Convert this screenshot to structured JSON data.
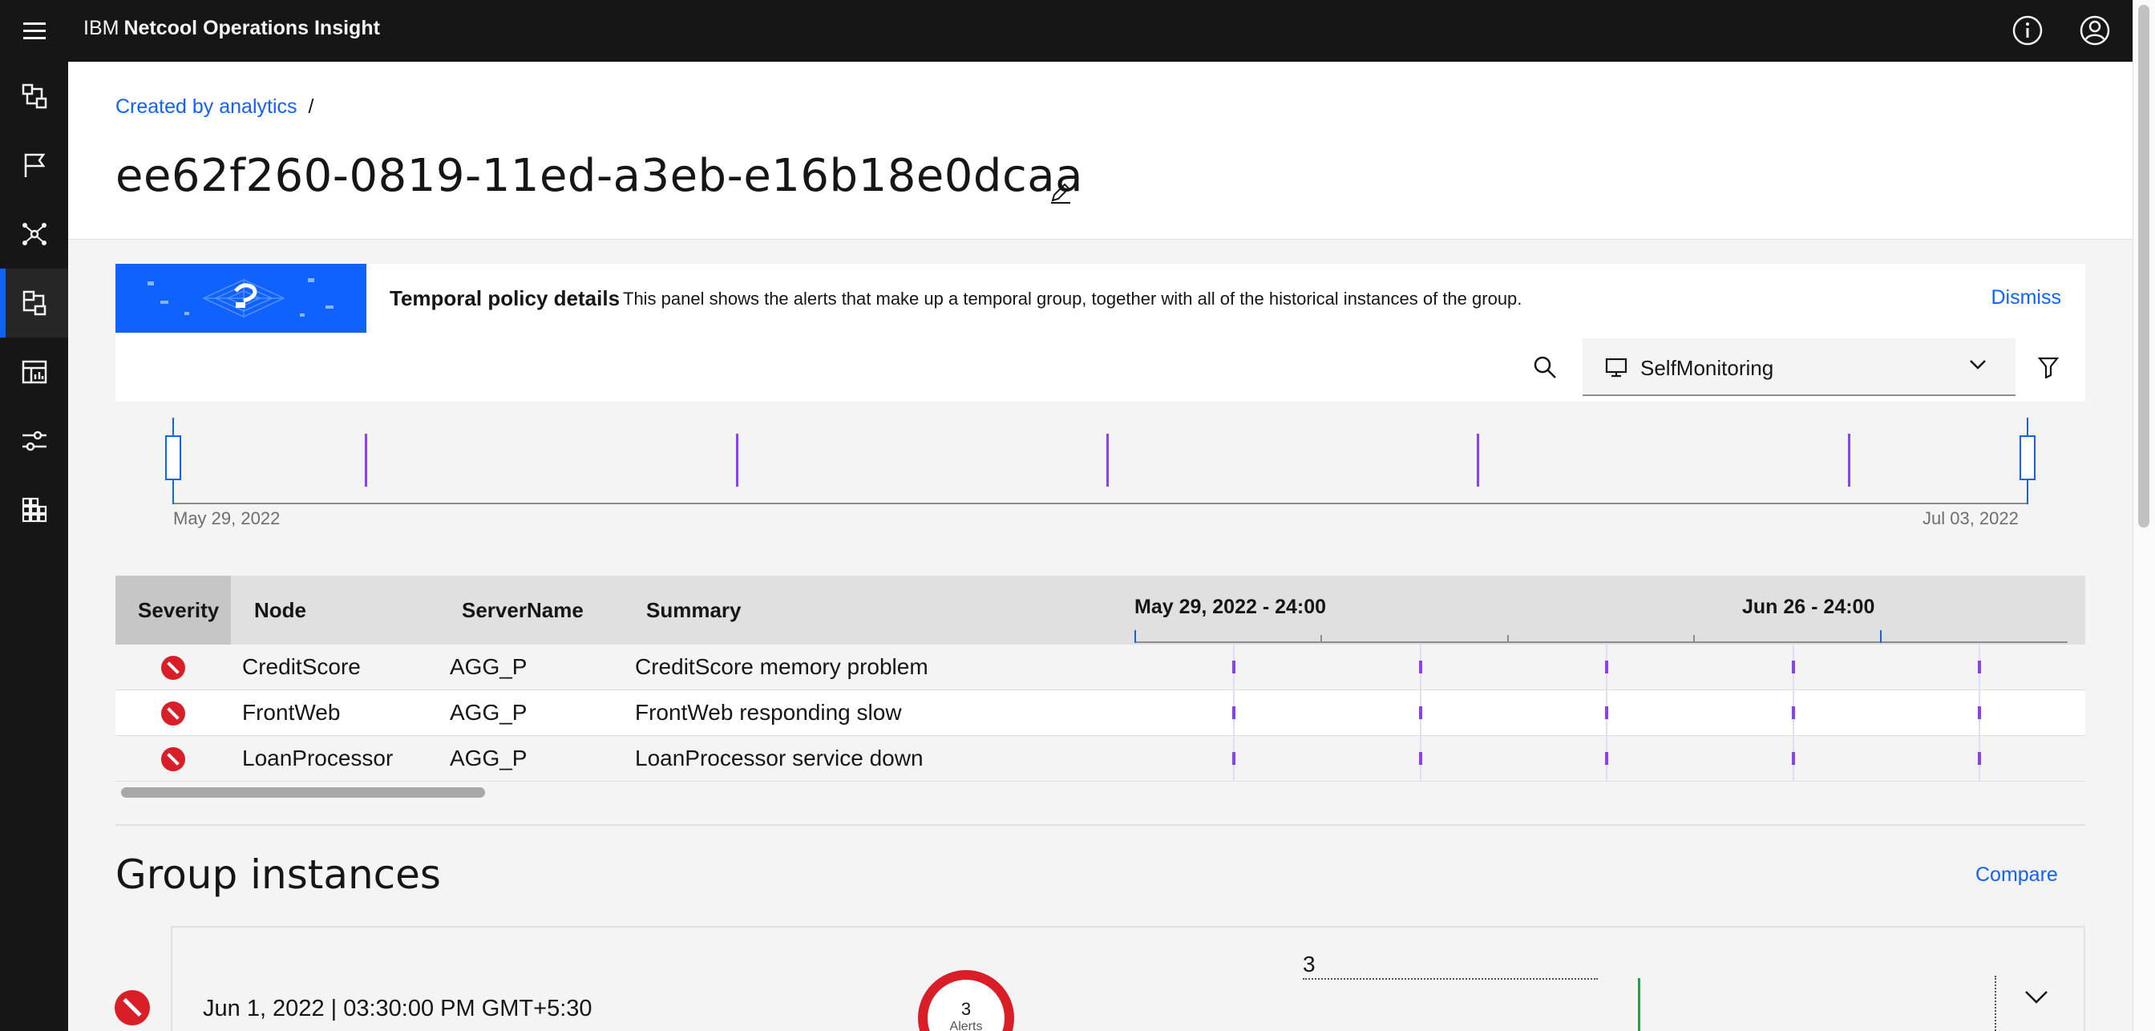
{
  "header": {
    "brand": "IBM",
    "product": "Netcool Operations Insight"
  },
  "breadcrumb": {
    "link": "Created by analytics",
    "separator": "/"
  },
  "page": {
    "title": "ee62f260-0819-11ed-a3eb-e16b18e0dcaa"
  },
  "info_panel": {
    "heading": "Temporal policy details",
    "description": "This panel shows the alerts that make up a temporal group, together with all of the historical instances of the group.",
    "dismiss_label": "Dismiss"
  },
  "toolbar": {
    "dropdown_value": "SelfMonitoring"
  },
  "timeline": {
    "start_label": "May 29, 2022",
    "end_label": "Jul 03, 2022"
  },
  "alerts_table": {
    "columns": [
      "Severity",
      "Node",
      "ServerName",
      "Summary"
    ],
    "gantt_headers": [
      "May 29, 2022 - 24:00",
      "Jun 26 - 24:00"
    ],
    "rows": [
      {
        "node": "CreditScore",
        "server": "AGG_P",
        "summary": "CreditScore memory problem"
      },
      {
        "node": "FrontWeb",
        "server": "AGG_P",
        "summary": "FrontWeb responding slow"
      },
      {
        "node": "LoanProcessor",
        "server": "AGG_P",
        "summary": "LoanProcessor service down"
      }
    ]
  },
  "group_instances": {
    "title": "Group instances",
    "compare_label": "Compare",
    "instances": [
      {
        "date": "Jun 1, 2022 | 03:30:00 PM GMT+5:30",
        "alert_count": "3",
        "alert_label": "Alerts",
        "spark_value": "3"
      }
    ]
  },
  "colors": {
    "accent": "#0f62fe",
    "critical": "#da1e28",
    "temporal_marker": "#8a3ffc",
    "spark_bar": "#24a148"
  },
  "icons": {
    "nav": [
      "incidents-icon",
      "flag-icon",
      "topology-icon",
      "policies-icon",
      "dashboard-icon",
      "settings-sliders-icon",
      "applications-icon"
    ],
    "header": [
      "info-icon",
      "user-avatar-icon"
    ]
  }
}
